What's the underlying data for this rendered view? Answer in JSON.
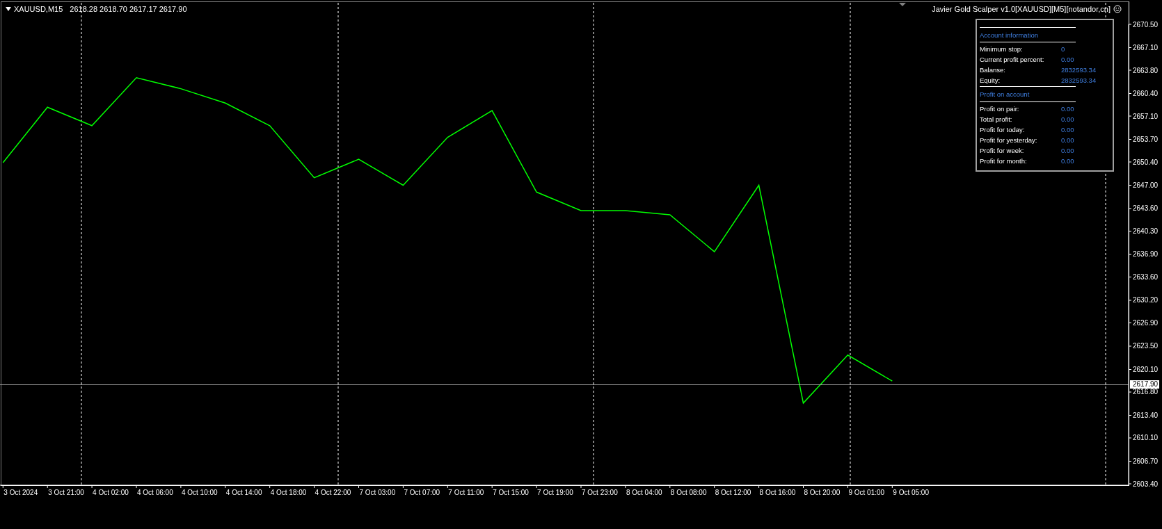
{
  "chart_header": {
    "symbol": "XAUUSD,M15",
    "quotes": "2618.28 2618.70 2617.17 2617.90"
  },
  "expert": {
    "title": "Javier Gold Scalper v1.0[XAUUSD][M5][notandor,cn]"
  },
  "panel": {
    "sections": [
      {
        "title": "Account information",
        "rows": [
          {
            "label": "Minimum stop:",
            "value": "0"
          },
          {
            "label": "Current profit percent:",
            "value": "0.00"
          },
          {
            "label": "Balanse:",
            "value": "2832593.34"
          },
          {
            "label": "Equity:",
            "value": "2832593.34"
          }
        ]
      },
      {
        "title": "Profit on account",
        "rows": [
          {
            "label": "Profit on pair:",
            "value": "0.00"
          },
          {
            "label": "Total profit:",
            "value": "0.00"
          },
          {
            "label": "Profit for today:",
            "value": "0.00"
          },
          {
            "label": "Profit for yesterday:",
            "value": "0.00"
          },
          {
            "label": "Profit for week:",
            "value": "0.00"
          },
          {
            "label": "Profit for month:",
            "value": "0.00"
          }
        ]
      }
    ]
  },
  "current_price": "2617.90",
  "chart": {
    "chart_data": {
      "type": "line",
      "categories": [
        "3 Oct 2024",
        "3 Oct 21:00",
        "4 Oct 02:00",
        "4 Oct 06:00",
        "4 Oct 10:00",
        "4 Oct 14:00",
        "4 Oct 18:00",
        "4 Oct 22:00",
        "7 Oct 03:00",
        "7 Oct 07:00",
        "7 Oct 11:00",
        "7 Oct 15:00",
        "7 Oct 19:00",
        "7 Oct 23:00",
        "8 Oct 04:00",
        "8 Oct 08:00",
        "8 Oct 12:00",
        "8 Oct 16:00",
        "8 Oct 20:00",
        "9 Oct 01:00",
        "9 Oct 05:00"
      ],
      "series": [
        {
          "color": "#00ff00",
          "values": [
            2650.3,
            2658.4,
            2655.7,
            2662.7,
            2661.1,
            2659.0,
            2655.7,
            2648.1,
            2650.8,
            2647.0,
            2654.0,
            2657.9,
            2646.0,
            2643.3,
            2643.3,
            2642.7,
            2637.3,
            2647.0,
            2615.2,
            2622.2,
            2618.4
          ]
        }
      ],
      "ylim": [
        2603.4,
        2670.5
      ],
      "yticks": [
        {
          "value": 2670.5,
          "label": "2670.50"
        },
        {
          "value": 2667.1,
          "label": "2667.10"
        },
        {
          "value": 2663.8,
          "label": "2663.80"
        },
        {
          "value": 2660.4,
          "label": "2660.40"
        },
        {
          "value": 2657.1,
          "label": "2657.10"
        },
        {
          "value": 2653.7,
          "label": "2653.70"
        },
        {
          "value": 2650.4,
          "label": "2650.40"
        },
        {
          "value": 2647.0,
          "label": "2647.00"
        },
        {
          "value": 2643.6,
          "label": "2643.60"
        },
        {
          "value": 2640.3,
          "label": "2640.30"
        },
        {
          "value": 2636.9,
          "label": "2636.90"
        },
        {
          "value": 2633.6,
          "label": "2633.60"
        },
        {
          "value": 2630.2,
          "label": "2630.20"
        },
        {
          "value": 2626.9,
          "label": "2626.90"
        },
        {
          "value": 2623.5,
          "label": "2623.50"
        },
        {
          "value": 2620.1,
          "label": "2620.10"
        },
        {
          "value": 2616.8,
          "label": "2616.80"
        },
        {
          "value": 2613.4,
          "label": "2613.40"
        },
        {
          "value": 2610.1,
          "label": "2610.10"
        },
        {
          "value": 2606.7,
          "label": "2606.70"
        },
        {
          "value": 2603.4,
          "label": "2603.40"
        }
      ]
    }
  }
}
